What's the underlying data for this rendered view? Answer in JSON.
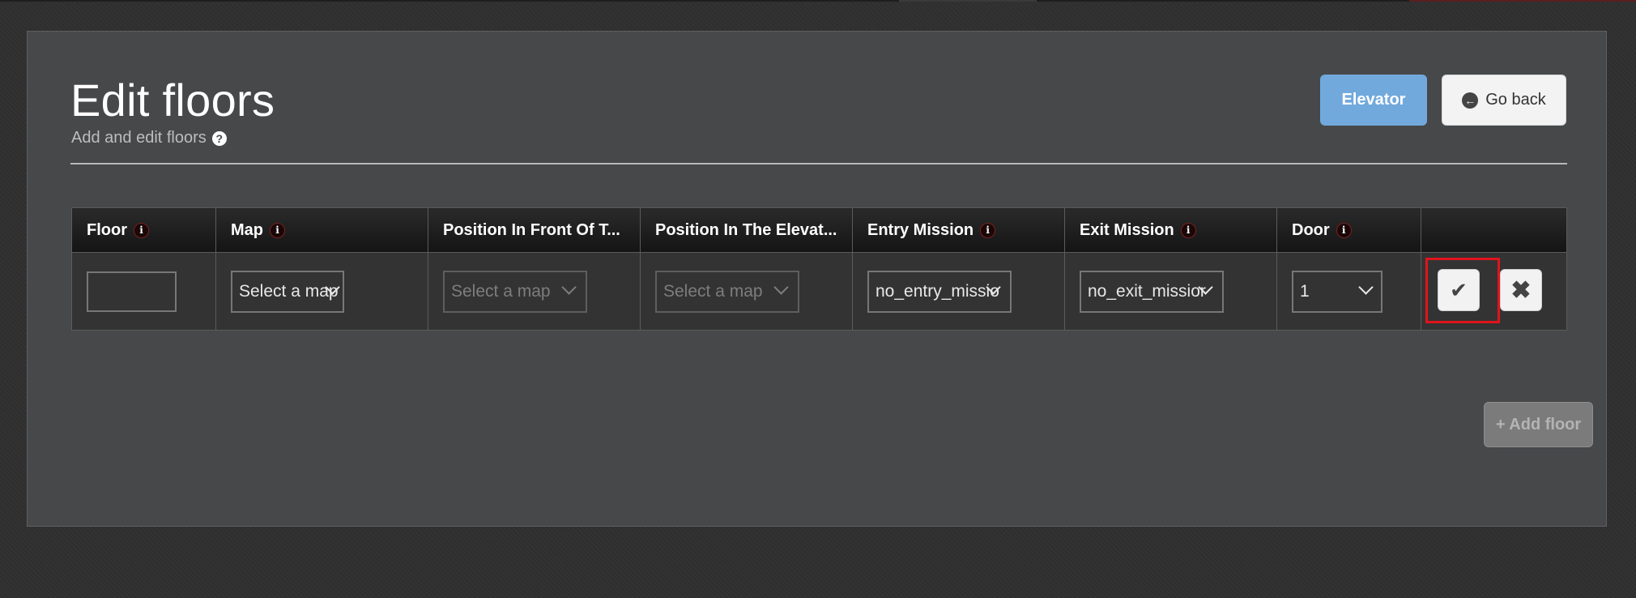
{
  "page": {
    "title": "Edit floors",
    "subtitle": "Add and edit floors",
    "help_icon": "?"
  },
  "header_buttons": {
    "elevator_label": "Elevator",
    "go_back_label": "Go back",
    "go_back_icon": "circle-arrow-left-icon"
  },
  "table": {
    "columns": [
      {
        "label": "Floor",
        "info": "i"
      },
      {
        "label": "Map",
        "info": "i"
      },
      {
        "label": "Position In Front Of T...",
        "info": ""
      },
      {
        "label": "Position In The Elevat...",
        "info": ""
      },
      {
        "label": "Entry Mission",
        "info": "i"
      },
      {
        "label": "Exit Mission",
        "info": "i"
      },
      {
        "label": "Door",
        "info": "i"
      },
      {
        "label": "",
        "info": ""
      }
    ],
    "row": {
      "floor_value": "",
      "map": "Select a map",
      "position_front": "Select a map",
      "position_elevator": "Select a map",
      "entry_mission": "no_entry_missio",
      "exit_mission": "no_exit_missior",
      "door": "1",
      "confirm_icon": "✔",
      "cancel_icon": "✖"
    }
  },
  "add_floor_label": "+ Add floor",
  "colors": {
    "panel": "#46484a",
    "elevator_button": "#72a9dc",
    "highlight": "#e0141b",
    "add_button_disabled": "#7b7b7b"
  }
}
